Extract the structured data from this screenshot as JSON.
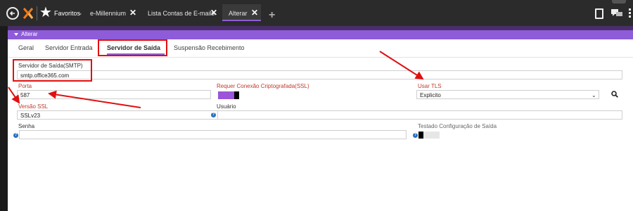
{
  "topbar": {
    "favorites_label": "Favoritos",
    "favorites_chevron": "⌄",
    "tabs": [
      {
        "label": "e-Millennium",
        "close": "✕"
      },
      {
        "label": "Lista Contas de E-mails",
        "close": "✕"
      },
      {
        "label": "Alterar",
        "close": "✕"
      }
    ],
    "plus": "+",
    "icons": [
      "back-arrow-icon",
      "logo-icon",
      "star-icon",
      "clipboard-icon",
      "chat-icon",
      "kebab-menu-icon"
    ]
  },
  "panel": {
    "title": "Alterar"
  },
  "page_tabs": [
    "Geral",
    "Servidor Entrada",
    "Servidor de Saída",
    "Suspensão Recebimento"
  ],
  "active_tab": "Servidor de Saída",
  "fields": {
    "smtp": {
      "label": "Servidor de Saída(SMTP)",
      "value": "smtp.office365.com"
    },
    "porta": {
      "label": "Porta",
      "value": "587"
    },
    "ssl_required": {
      "label": "Requer Conexão Criptografada(SSL)",
      "checked": true
    },
    "tls": {
      "label": "Usar TLS",
      "value": "Explicito"
    },
    "ssl_version": {
      "label": "Versão SSL",
      "value": "SSLv23"
    },
    "usuario": {
      "label": "Usuário",
      "value": ""
    },
    "senha": {
      "label": "Senha",
      "value": ""
    },
    "tested": {
      "label": "Testado Configuração de Saída",
      "checked": false
    }
  },
  "help_glyph": "?",
  "chevron": "⌄",
  "colors": {
    "accent": "#8e5cd8",
    "annotation": "#e01010",
    "label_red": "#c0392b"
  }
}
